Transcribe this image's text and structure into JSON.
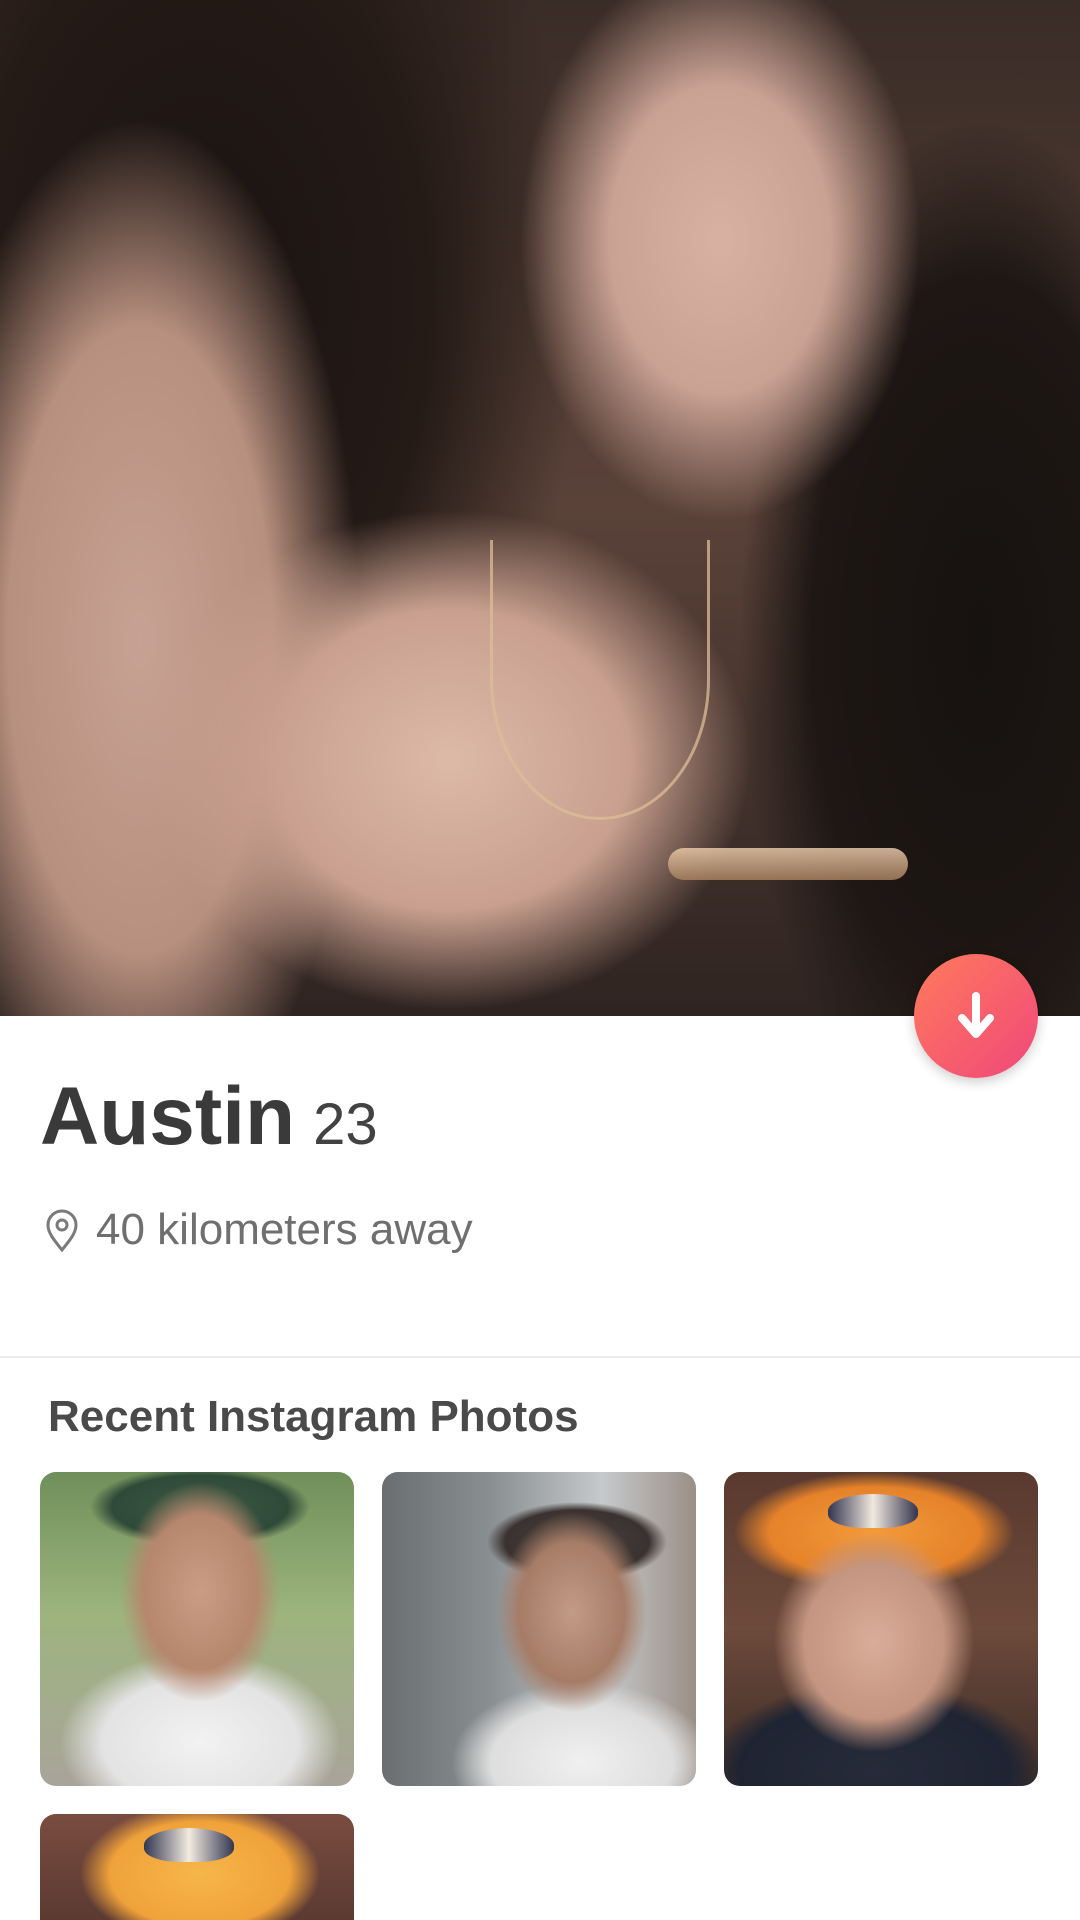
{
  "profile": {
    "name": "Austin",
    "age": "23",
    "distance": "40 kilometers away"
  },
  "instagram": {
    "section_title": "Recent Instagram Photos",
    "photo_count_visible": 4
  },
  "icons": {
    "fab": "arrow-down-icon",
    "location": "location-pin-icon"
  },
  "colors": {
    "fab_gradient_start": "#ff7a5c",
    "fab_gradient_end": "#f0487a",
    "name_text": "#3a3a3a",
    "secondary_text": "#6f6f6f",
    "divider": "#ececec"
  }
}
